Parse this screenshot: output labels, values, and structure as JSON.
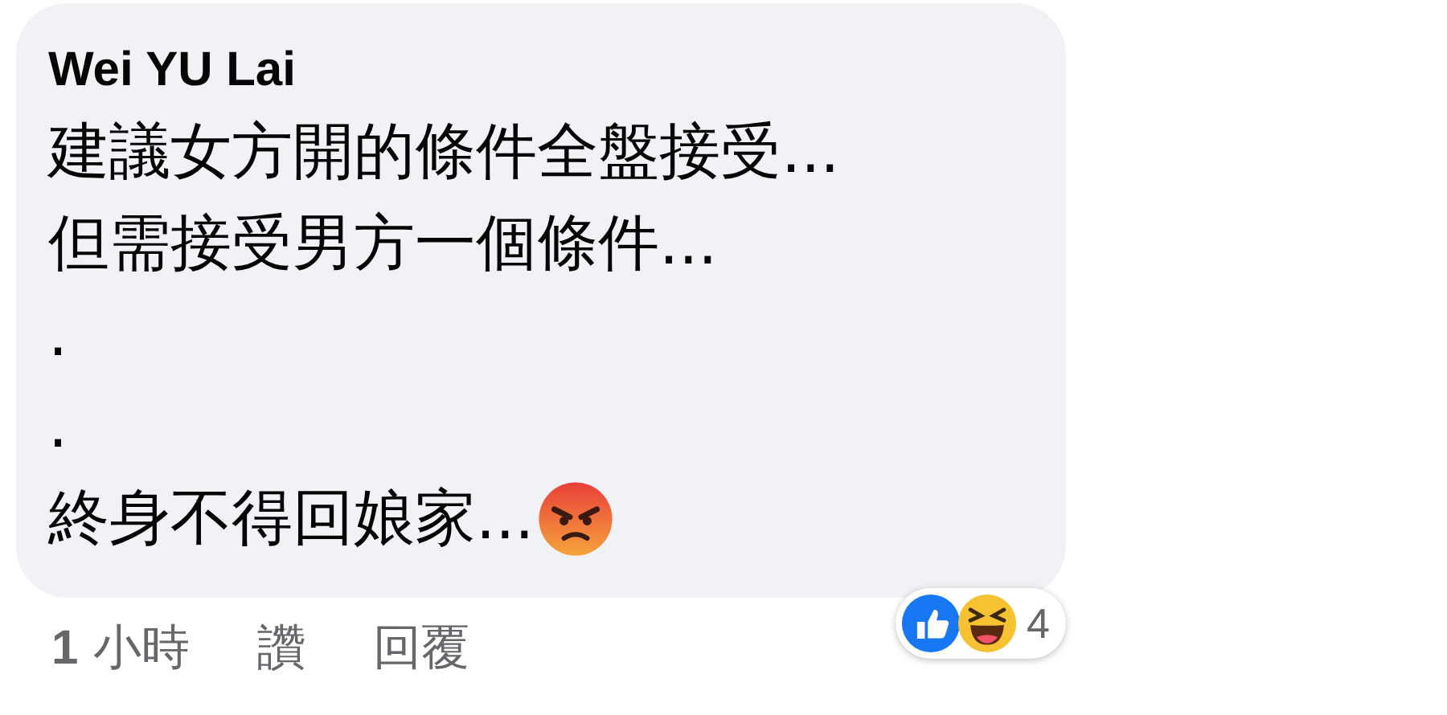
{
  "comment": {
    "author": "Wei YU Lai",
    "lines": [
      "建議女方開的條件全盤接受...",
      "但需接受男方一個條件...",
      ".",
      ".",
      "終身不得回娘家..."
    ],
    "reaction_count": "4"
  },
  "footer": {
    "time": "**1** 小時",
    "actions": [
      "讚",
      "回覆"
    ]
  }
}
